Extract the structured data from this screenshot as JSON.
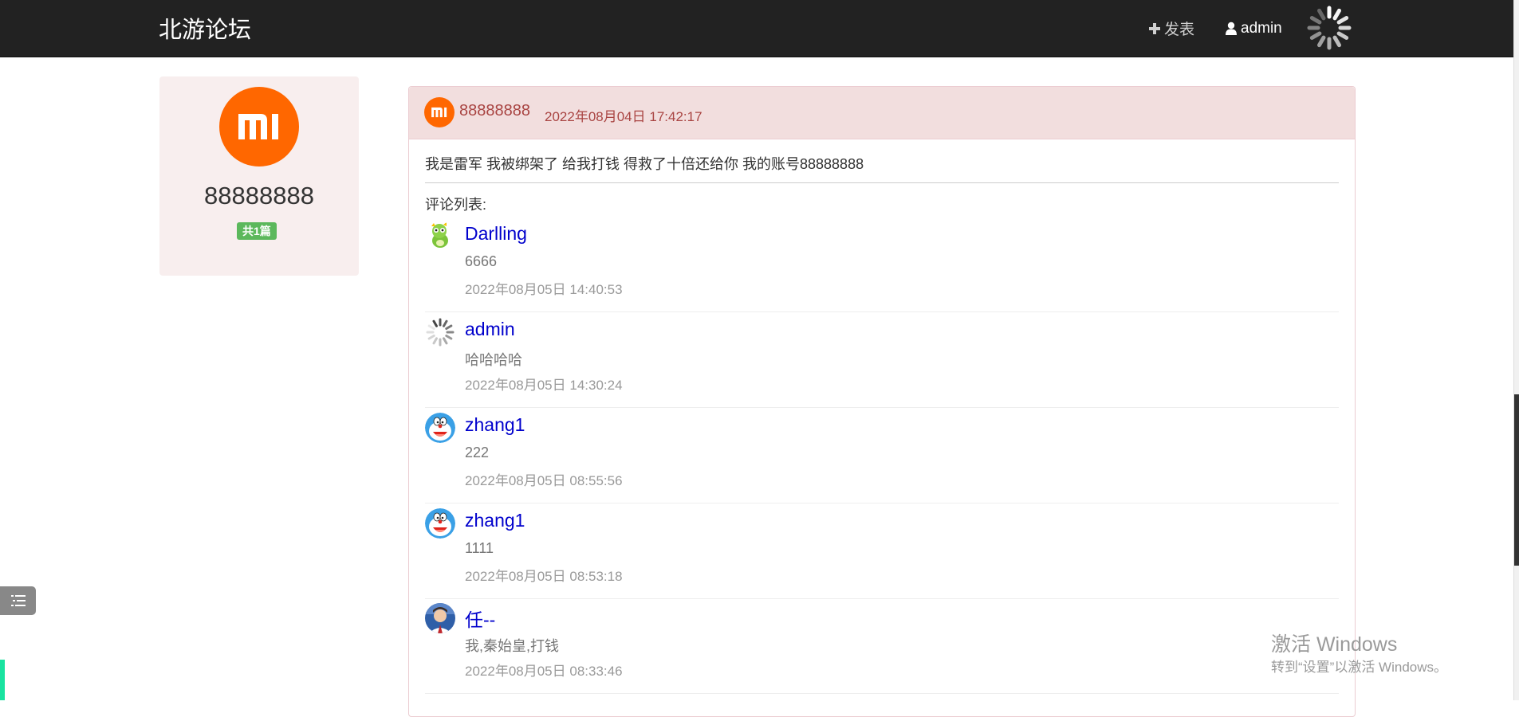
{
  "navbar": {
    "brand": "北游论坛",
    "post_label": "发表",
    "user_label": "admin"
  },
  "profile": {
    "name": "88888888",
    "badge": "共1篇",
    "avatar_text": "MI"
  },
  "post": {
    "author": "88888888",
    "time": "2022年08月04日 17:42:17",
    "content": "我是雷军 我被绑架了 给我打钱 得救了十倍还给你 我的账号88888888",
    "comments_label": "评论列表:"
  },
  "comments": [
    {
      "name": "Darlling",
      "text": "6666",
      "time": "2022年08月05日 14:40:53",
      "avatar": "green-dinosaur-avatar"
    },
    {
      "name": "admin",
      "text": "哈哈哈哈",
      "time": "2022年08月05日 14:30:24",
      "avatar": "loading-spinner-avatar"
    },
    {
      "name": "zhang1",
      "text": "222",
      "time": "2022年08月05日 08:55:56",
      "avatar": "doraemon-avatar"
    },
    {
      "name": "zhang1",
      "text": "1111",
      "time": "2022年08月05日 08:53:18",
      "avatar": "doraemon-avatar"
    },
    {
      "name": "任--",
      "text": "我,秦始皇,打钱",
      "time": "2022年08月05日 08:33:46",
      "avatar": "portrait-avatar"
    }
  ],
  "watermark": {
    "title": "激活 Windows",
    "subtitle": "转到“设置”以激活 Windows。"
  },
  "colors": {
    "navbar": "#222222",
    "accent_mi": "#ff6700",
    "badge": "#5cb85c",
    "panel_heading": "#f2dede",
    "comment_name": "#0000cc"
  }
}
